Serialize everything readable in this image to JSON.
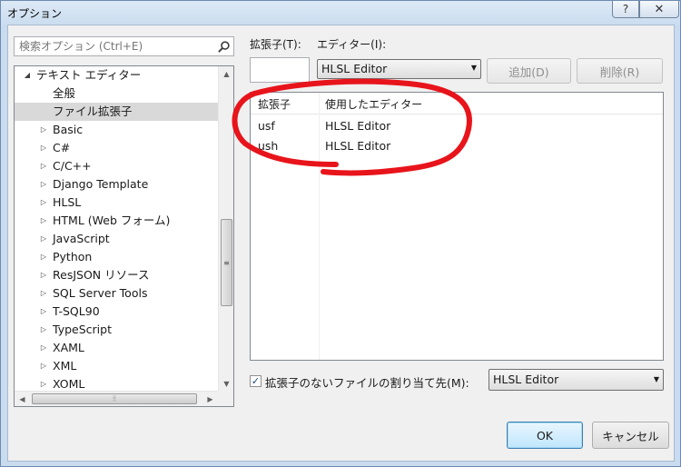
{
  "window": {
    "title": "オプション",
    "help_label": "?",
    "close_label": "✕"
  },
  "search": {
    "placeholder": "検索オプション (Ctrl+E)",
    "icon": "search-icon"
  },
  "tree": {
    "items": [
      {
        "label": "テキスト エディター",
        "level": 0,
        "state": "expanded"
      },
      {
        "label": "全般",
        "level": 1,
        "state": "none"
      },
      {
        "label": "ファイル拡張子",
        "level": 1,
        "state": "none",
        "selected": true
      },
      {
        "label": "Basic",
        "level": 1,
        "state": "collapsed"
      },
      {
        "label": "C#",
        "level": 1,
        "state": "collapsed"
      },
      {
        "label": "C/C++",
        "level": 1,
        "state": "collapsed"
      },
      {
        "label": "Django Template",
        "level": 1,
        "state": "collapsed"
      },
      {
        "label": "HLSL",
        "level": 1,
        "state": "collapsed"
      },
      {
        "label": "HTML (Web フォーム)",
        "level": 1,
        "state": "collapsed"
      },
      {
        "label": "JavaScript",
        "level": 1,
        "state": "collapsed"
      },
      {
        "label": "Python",
        "level": 1,
        "state": "collapsed"
      },
      {
        "label": "ResJSON リソース",
        "level": 1,
        "state": "collapsed"
      },
      {
        "label": "SQL Server Tools",
        "level": 1,
        "state": "collapsed"
      },
      {
        "label": "T-SQL90",
        "level": 1,
        "state": "collapsed"
      },
      {
        "label": "TypeScript",
        "level": 1,
        "state": "collapsed"
      },
      {
        "label": "XAML",
        "level": 1,
        "state": "collapsed"
      },
      {
        "label": "XML",
        "level": 1,
        "state": "collapsed"
      },
      {
        "label": "XOML",
        "level": 1,
        "state": "collapsed"
      }
    ]
  },
  "extension_panel": {
    "extension_label": "拡張子(T):",
    "extension_value": "",
    "editor_label": "エディター(I):",
    "editor_selected": "HLSL Editor",
    "add_button": "追加(D)",
    "remove_button": "削除(R)"
  },
  "mapping_list": {
    "columns": [
      "拡張子",
      "使用したエディター"
    ],
    "rows": [
      {
        "ext": "usf",
        "editor": "HLSL Editor"
      },
      {
        "ext": "ush",
        "editor": "HLSL Editor"
      }
    ]
  },
  "no_extension": {
    "checked": true,
    "label": "拡張子のないファイルの割り当て先(M):",
    "editor_selected": "HLSL Editor"
  },
  "footer": {
    "ok_label": "OK",
    "cancel_label": "キャンセル"
  },
  "annotation": {
    "color": "#e8141b"
  }
}
